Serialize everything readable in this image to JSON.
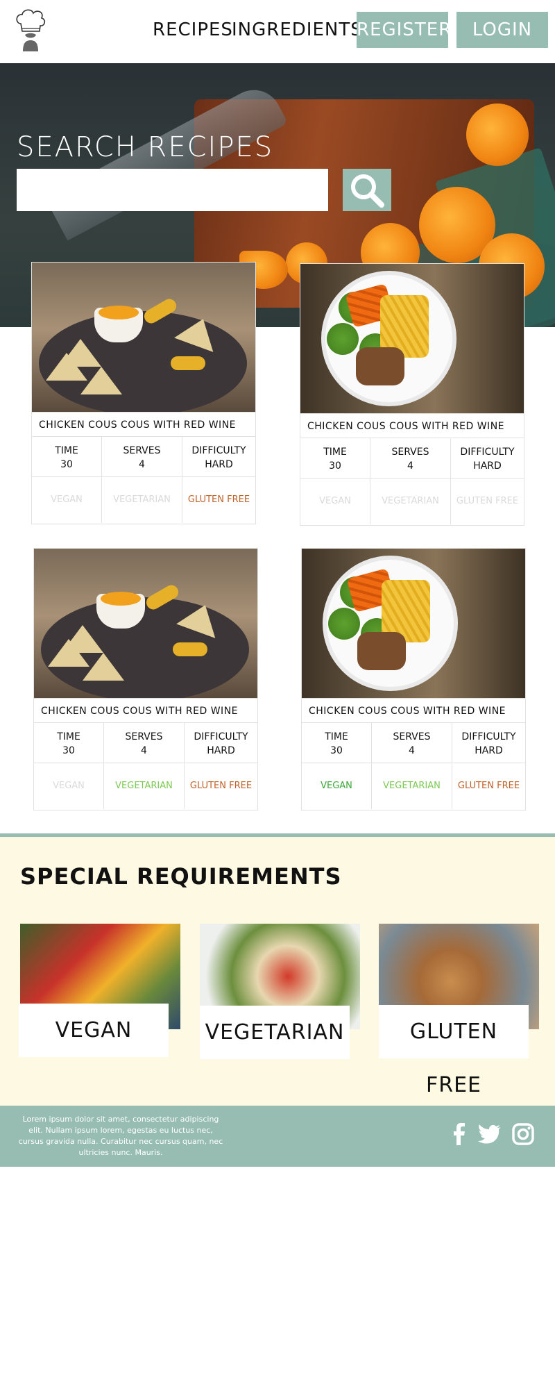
{
  "nav": {
    "recipes": "RECIPES",
    "ingredients": "INGREDIENTS",
    "register": "REGISTER",
    "login": "LOGIN",
    "logo_icon": "chef-hat-icon"
  },
  "hero": {
    "title": "SEARCH RECIPES",
    "search_placeholder": "",
    "search_icon": "magnifier-icon"
  },
  "recipes": [
    {
      "title": "CHICKEN COUS COUS WITH RED WINE",
      "image": "nachos-platter",
      "meta": [
        {
          "label": "TIME",
          "value": "30"
        },
        {
          "label": "SERVES",
          "value": "4"
        },
        {
          "label": "DIFFICULTY",
          "value": "HARD"
        }
      ],
      "tags": [
        {
          "label": "VEGAN",
          "state": "off"
        },
        {
          "label": "VEGETARIAN",
          "state": "off"
        },
        {
          "label": "GLUTEN FREE",
          "state": "gf"
        }
      ]
    },
    {
      "title": "CHICKEN COUS COUS WITH RED WINE",
      "image": "chicken-plate",
      "meta": [
        {
          "label": "TIME",
          "value": "30"
        },
        {
          "label": "SERVES",
          "value": "4"
        },
        {
          "label": "DIFFICULTY",
          "value": "HARD"
        }
      ],
      "tags": [
        {
          "label": "VEGAN",
          "state": "off"
        },
        {
          "label": "VEGETARIAN",
          "state": "off"
        },
        {
          "label": "GLUTEN FREE",
          "state": "off"
        }
      ]
    },
    {
      "title": "CHICKEN COUS COUS WITH RED WINE",
      "image": "nachos-platter",
      "meta": [
        {
          "label": "TIME",
          "value": "30"
        },
        {
          "label": "SERVES",
          "value": "4"
        },
        {
          "label": "DIFFICULTY",
          "value": "HARD"
        }
      ],
      "tags": [
        {
          "label": "VEGAN",
          "state": "off"
        },
        {
          "label": "VEGETARIAN",
          "state": "veg"
        },
        {
          "label": "GLUTEN FREE",
          "state": "gf"
        }
      ]
    },
    {
      "title": "CHICKEN COUS COUS WITH RED WINE",
      "image": "chicken-plate",
      "meta": [
        {
          "label": "TIME",
          "value": "30"
        },
        {
          "label": "SERVES",
          "value": "4"
        },
        {
          "label": "DIFFICULTY",
          "value": "HARD"
        }
      ],
      "tags": [
        {
          "label": "VEGAN",
          "state": "vegan"
        },
        {
          "label": "VEGETARIAN",
          "state": "veg"
        },
        {
          "label": "GLUTEN FREE",
          "state": "gf"
        }
      ]
    }
  ],
  "special": {
    "title": "SPECIAL REQUIREMENTS",
    "items": [
      {
        "label": "VEGAN",
        "image": "produce"
      },
      {
        "label": "VEGETARIAN",
        "image": "salad"
      },
      {
        "label": "GLUTEN FREE",
        "image": "bread"
      }
    ]
  },
  "footer": {
    "text": "Lorem ipsum dolor sit amet, consectetur adipiscing elit. Nullam ipsum lorem, egestas eu luctus nec, cursus gravida nulla. Curabitur nec cursus quam, nec ultricies nunc. Mauris.",
    "social": [
      "facebook-icon",
      "twitter-icon",
      "instagram-icon"
    ]
  },
  "colors": {
    "accent": "#97bdb3",
    "special_bg": "#fdf9e3",
    "tag_off": "#dadada",
    "tag_vegetarian": "#7dc953",
    "tag_vegan": "#3aa836",
    "tag_gluten_free": "#c0622a"
  }
}
